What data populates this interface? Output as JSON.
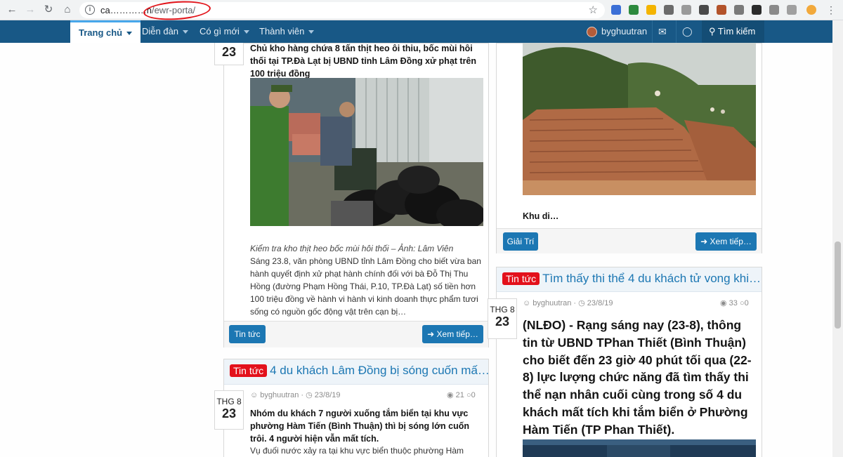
{
  "browser": {
    "url_host": "ca…………n",
    "url_path": "/ewr-porta/"
  },
  "nav": {
    "home": "Trang chủ",
    "forums": "Diễn đàn",
    "whats_new": "Có gì mới",
    "members": "Thành viên",
    "username": "byghuutran",
    "search": "Tìm kiếm"
  },
  "left_col": {
    "article1": {
      "day": "23",
      "headline": "Chủ kho hàng chứa 8 tấn thịt heo ôi thiu, bốc mùi hôi thối tại TP.Đà Lạt bị UBND tỉnh Lâm Đồng xử phạt trên 100 triệu đồng",
      "caption": "Kiểm tra kho thịt heo bốc mùi hôi thối – Ảnh: Lâm Viên",
      "body": "Sáng 23.8, văn phòng UBND tỉnh Lâm Đồng cho biết vừa ban hành quyết định xử phạt hành chính đối với bà Đỗ Thị Thu Hồng (đường Phạm Hồng Thái, P.10, TP.Đà Lạt) số tiền hơn 100 triệu đồng về hành vi hành vi kinh doanh thực phẩm tươi sống có nguồn gốc động vật trên cạn bị…",
      "category": "Tin tức",
      "read_more": "Xem tiếp…"
    },
    "article2": {
      "tag": "Tin tức",
      "title": "4 du khách Lâm Đồng bị sóng cuốn mấ…",
      "author": "byghuutran",
      "date": "23/8/19",
      "views": "21",
      "comments": "0",
      "month": "THG 8",
      "day": "23",
      "lead": "Nhóm du khách 7 người xuống tắm biển tại khu vực phường Hàm Tiến (Bình Thuận) thì bị sóng lớn cuốn trôi. 4 người hiện vẫn mất tích.",
      "body": "Vụ đuối nước xảy ra tại khu vực biển thuộc phường Hàm"
    }
  },
  "right_col": {
    "article1": {
      "excerpt": "Khu di…",
      "category": "Giải Trí",
      "read_more": "Xem tiếp…"
    },
    "article2": {
      "tag": "Tin tức",
      "title": "Tìm thấy thi thể 4 du khách tử vong khi…",
      "author": "byghuutran",
      "date": "23/8/19",
      "views": "33",
      "comments": "0",
      "month": "THG 8",
      "day": "23",
      "body": "(NLĐO) - Rạng sáng nay (23-8), thông tin từ UBND TPhan Thiết (Bình Thuận) cho biết đến 23 giờ 40 phút tối qua (22-8) lực lượng chức năng đã tìm thấy thi thể nạn nhân cuối cùng trong số 4 du khách mất tích khi tắm biển ở Phường Hàm Tiến (TP Phan Thiết)."
    }
  },
  "colors": {
    "nav_bg": "#185886",
    "accent": "#1c77b3",
    "tag_red": "#e3111b"
  }
}
